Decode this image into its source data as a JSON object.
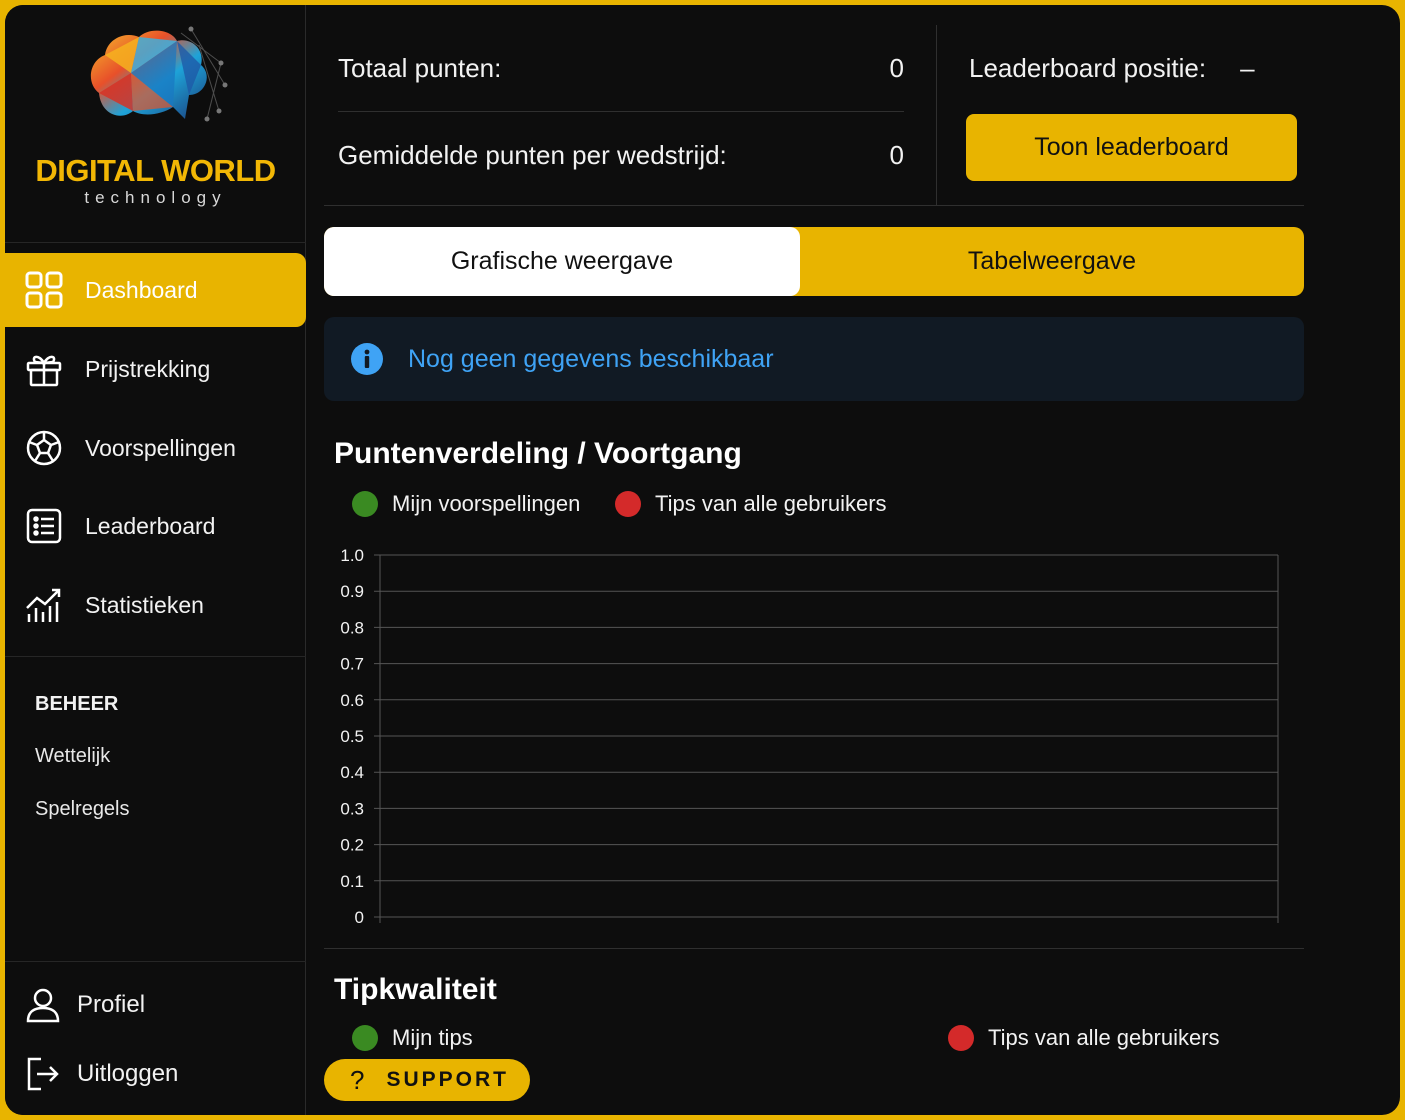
{
  "brand": {
    "name": "DIGITAL WORLD",
    "tagline": "technology"
  },
  "sidebar": {
    "items": [
      {
        "label": "Dashboard",
        "icon": "grid-icon",
        "active": true
      },
      {
        "label": "Prijstrekking",
        "icon": "gift-icon"
      },
      {
        "label": "Voorspellingen",
        "icon": "soccer-ball-icon"
      },
      {
        "label": "Leaderboard",
        "icon": "list-icon"
      },
      {
        "label": "Statistieken",
        "icon": "chart-icon"
      }
    ],
    "section_title": "BEHEER",
    "links": [
      "Wettelijk",
      "Spelregels"
    ],
    "bottom": [
      {
        "label": "Profiel",
        "icon": "user-icon"
      },
      {
        "label": "Uitloggen",
        "icon": "logout-icon"
      }
    ]
  },
  "stats": {
    "total_label": "Totaal punten:",
    "total_value": "0",
    "avg_label": "Gemiddelde punten per wedstrijd:",
    "avg_value": "0",
    "leaderboard_label": "Leaderboard positie:",
    "leaderboard_value": "–",
    "leaderboard_button": "Toon leaderboard"
  },
  "tabs": {
    "graphic": "Grafische weergave",
    "table": "Tabelweergave"
  },
  "info": {
    "message": "Nog geen gegevens beschikbaar"
  },
  "chart": {
    "title": "Puntenverdeling / Voortgang",
    "legend_mine": "Mijn voorspellingen",
    "legend_all": "Tips van alle gebruikers",
    "color_mine": "#3a8a22",
    "color_all": "#d42a2a"
  },
  "chart_data": {
    "type": "line",
    "title": "Puntenverdeling / Voortgang",
    "series": [
      {
        "name": "Mijn voorspellingen",
        "values": []
      },
      {
        "name": "Tips van alle gebruikers",
        "values": []
      }
    ],
    "ylim": [
      0,
      1
    ],
    "yticks": [
      "0",
      "0.1",
      "0.2",
      "0.3",
      "0.4",
      "0.5",
      "0.6",
      "0.7",
      "0.8",
      "0.9",
      "1.0"
    ],
    "grid": true,
    "legend": "top-left"
  },
  "tip_quality": {
    "title": "Tipkwaliteit",
    "legend_mine": "Mijn tips",
    "legend_all": "Tips van alle gebruikers"
  },
  "support": {
    "label": "SUPPORT"
  }
}
